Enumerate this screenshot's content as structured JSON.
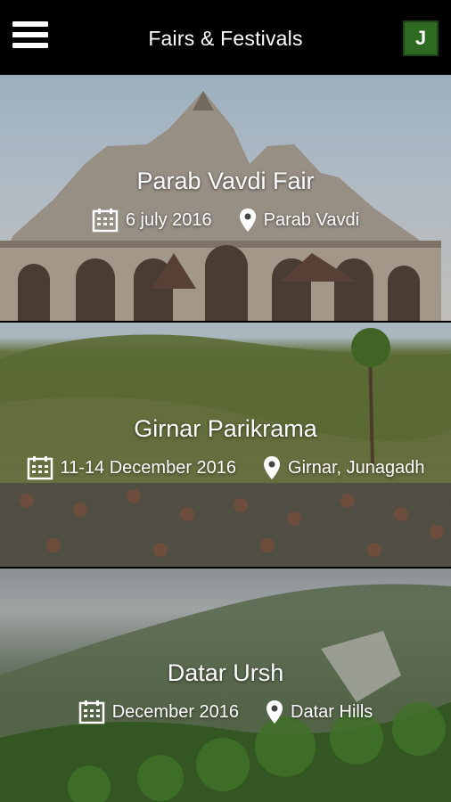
{
  "header": {
    "title": "Fairs & Festivals",
    "logo_letter": "J",
    "menu_icon": "hamburger-menu-icon",
    "brand_color": "#2e6a22"
  },
  "festivals": [
    {
      "name": "Parab Vavdi Fair",
      "date": "6 july 2016",
      "location": "Parab Vavdi"
    },
    {
      "name": "Girnar Parikrama",
      "date": "11-14 December 2016",
      "location": "Girnar, Junagadh"
    },
    {
      "name": "Datar Ursh",
      "date": "December 2016",
      "location": "Datar Hills"
    }
  ],
  "icons": {
    "date": "calendar-icon",
    "location": "location-pin-icon"
  }
}
